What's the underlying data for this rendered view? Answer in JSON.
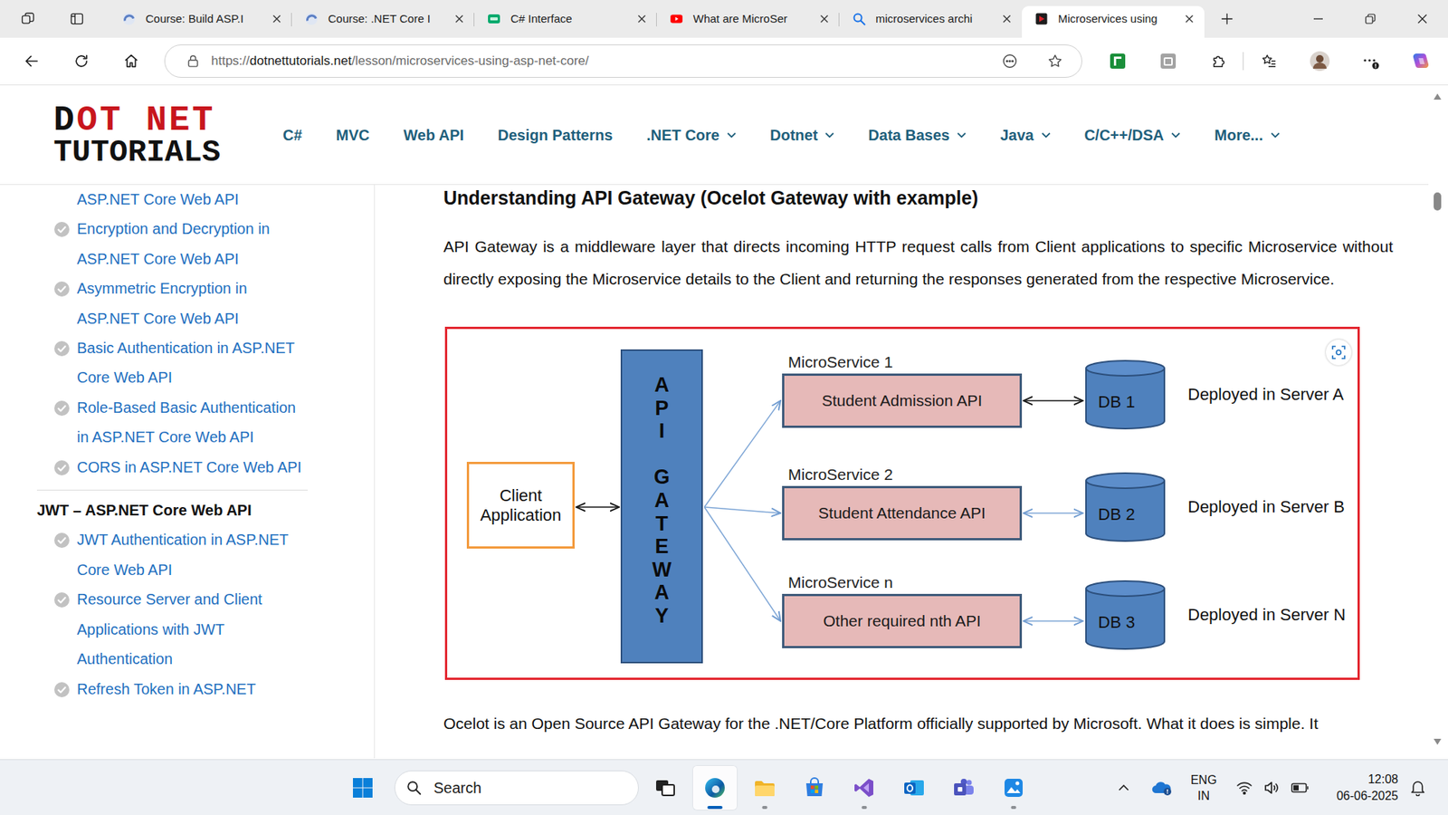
{
  "browser": {
    "tabs": [
      {
        "label": "Course: Build ASP.I",
        "kind": "course",
        "selected": false
      },
      {
        "label": "Course: .NET Core I",
        "kind": "course",
        "selected": false
      },
      {
        "label": "C# Interface",
        "kind": "w3",
        "selected": false
      },
      {
        "label": "What are MicroSer",
        "kind": "youtube",
        "selected": false
      },
      {
        "label": "microservices archi",
        "kind": "bing",
        "selected": false
      },
      {
        "label": "Microservices using",
        "kind": "dotnet",
        "selected": true
      }
    ],
    "url": {
      "scheme": "https://",
      "host": "dotnettutorials.net",
      "path": "/lesson/microservices-using-asp-net-core/"
    }
  },
  "site": {
    "logo": {
      "line1": "DOT NET",
      "line2": "TUTORIALS"
    },
    "nav": [
      {
        "label": "C#",
        "dropdown": false
      },
      {
        "label": "MVC",
        "dropdown": false
      },
      {
        "label": "Web API",
        "dropdown": false
      },
      {
        "label": "Design Patterns",
        "dropdown": false
      },
      {
        "label": ".NET Core",
        "dropdown": true
      },
      {
        "label": "Dotnet",
        "dropdown": true
      },
      {
        "label": "Data Bases",
        "dropdown": true
      },
      {
        "label": "Java",
        "dropdown": true
      },
      {
        "label": "C/C++/DSA",
        "dropdown": true
      },
      {
        "label": "More...",
        "dropdown": true
      }
    ]
  },
  "sidebar": {
    "items": [
      {
        "label": "ASP.NET Core Web API",
        "completed": false
      },
      {
        "label": "Encryption and Decryption in ASP.NET Core Web API",
        "completed": true
      },
      {
        "label": "Asymmetric Encryption in ASP.NET Core Web API",
        "completed": true
      },
      {
        "label": "Basic Authentication in ASP.NET Core Web API",
        "completed": true
      },
      {
        "label": "Role-Based Basic Authentication in ASP.NET Core Web API",
        "completed": true
      },
      {
        "label": "CORS in ASP.NET Core Web API",
        "completed": true
      }
    ],
    "section": {
      "title": "JWT – ASP.NET Core Web API",
      "items": [
        {
          "label": "JWT Authentication in ASP.NET Core Web API",
          "completed": true
        },
        {
          "label": "Resource Server and Client Applications with JWT Authentication",
          "completed": true
        },
        {
          "label": "Refresh Token in ASP.NET",
          "completed": true
        }
      ]
    }
  },
  "article": {
    "heading": "Understanding API Gateway (Ocelot Gateway with example)",
    "intro": "API Gateway is a middleware layer that directs incoming HTTP request calls from Client applications to specific Microservice without directly exposing the Microservice details to the Client and returning the responses generated from the respective Microservice.",
    "diagram": {
      "client": "Client Application",
      "gateway": "API GATEWAY",
      "services": [
        {
          "title": "MicroService 1",
          "api": "Student Admission API",
          "db": "DB 1",
          "server": "Deployed in Server A"
        },
        {
          "title": "MicroService 2",
          "api": "Student Attendance API",
          "db": "DB 2",
          "server": "Deployed in Server B"
        },
        {
          "title": "MicroService n",
          "api": "Other required nth API",
          "db": "DB 3",
          "server": "Deployed in Server N"
        }
      ]
    },
    "next": "Ocelot is an Open Source API Gateway for the .NET/Core Platform officially supported by Microsoft. What it does is simple. It"
  },
  "scrollbar": {
    "position": 0.143
  },
  "taskbar": {
    "search": {
      "label": "Search"
    },
    "apps": [
      {
        "kind": "taskview",
        "running": false,
        "active": false
      },
      {
        "kind": "edge",
        "running": true,
        "active": true
      },
      {
        "kind": "explorer",
        "running": true,
        "active": false
      },
      {
        "kind": "store",
        "running": false,
        "active": false
      },
      {
        "kind": "vs",
        "running": true,
        "active": false
      },
      {
        "kind": "outlook",
        "running": false,
        "active": false
      },
      {
        "kind": "teams",
        "running": false,
        "active": false
      },
      {
        "kind": "photos",
        "running": true,
        "active": false
      }
    ],
    "tray": {
      "language": "ENG",
      "region": "IN",
      "time": "12:08",
      "date": "06-06-2025"
    }
  }
}
